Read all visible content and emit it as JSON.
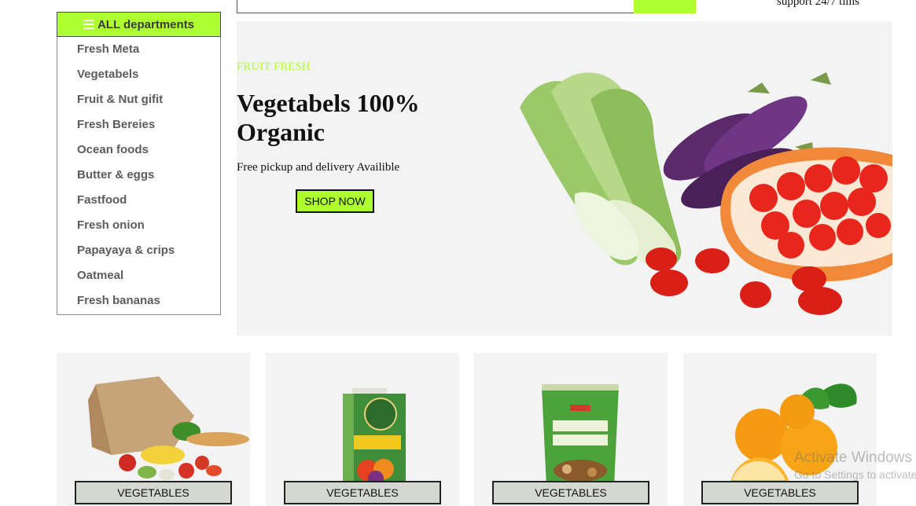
{
  "header": {
    "support_text": "support 24/7 tims"
  },
  "departments": {
    "title": "ALL departments",
    "items": [
      {
        "label": "Fresh Meta"
      },
      {
        "label": "Vegetabels"
      },
      {
        "label": "Fruit & Nut gifit"
      },
      {
        "label": "Fresh Bereies"
      },
      {
        "label": "Ocean foods"
      },
      {
        "label": "Butter & eggs"
      },
      {
        "label": "Fastfood"
      },
      {
        "label": "Fresh onion"
      },
      {
        "label": "Papayaya & crips"
      },
      {
        "label": "Oatmeal"
      },
      {
        "label": "Fresh bananas"
      }
    ]
  },
  "hero": {
    "eyebrow": "FRUIT FRESH",
    "title": "Vegetabels 100% Organic",
    "subtitle": "Free pickup and delivery Availible",
    "button_label": "SHOP NOW"
  },
  "cards": [
    {
      "button_label": "VEGETABLES",
      "image": "grocery-bag-image"
    },
    {
      "button_label": "VEGETABLES",
      "image": "juice-carton-image"
    },
    {
      "button_label": "VEGETABLES",
      "image": "snack-pack-image"
    },
    {
      "button_label": "VEGETABLES",
      "image": "oranges-image"
    }
  ],
  "watermark": {
    "line1": "Activate Windows",
    "line2": "Go to Settings to activate Windows."
  },
  "colors": {
    "accent": "#adff2f",
    "panel_bg": "#f3f3f3",
    "card_button_bg": "#d5d8d1"
  }
}
